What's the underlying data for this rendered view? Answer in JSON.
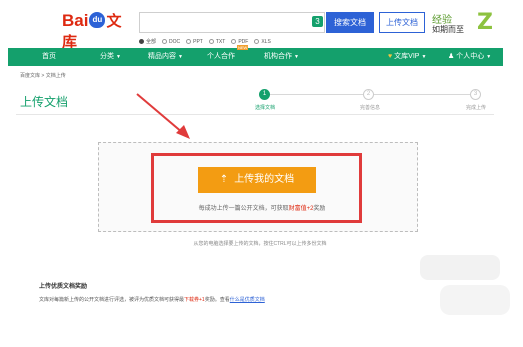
{
  "header": {
    "logo_bai": "Bai",
    "logo_du": "du",
    "logo_wenku": "文库",
    "search_value": "",
    "search_count": "3",
    "search_button": "搜索文档",
    "upload_button": "上传文档",
    "brand_line1": "经验",
    "brand_line2": "如期而至"
  },
  "filetypes": [
    {
      "label": "全部",
      "selected": true
    },
    {
      "label": "DOC",
      "selected": false
    },
    {
      "label": "PPT",
      "selected": false
    },
    {
      "label": "TXT",
      "selected": false
    },
    {
      "label": "PDF",
      "selected": false
    },
    {
      "label": "XLS",
      "selected": false
    }
  ],
  "nav": {
    "items": [
      "首页",
      "分类",
      "精品内容",
      "个人合作",
      "机构合作"
    ],
    "new_badge": "NEW",
    "vip": "文库VIP",
    "user_center": "个人中心"
  },
  "breadcrumb": "百度文库 > 文档上传",
  "page_title": "上传文档",
  "steps": {
    "labels": [
      "选择文档",
      "完善信息",
      "完成上传"
    ],
    "numbers": [
      "1",
      "2",
      "3"
    ],
    "active_index": 0
  },
  "upload": {
    "button_label": "上传我的文档",
    "reward_before": "每成功上传一篇公开文档，可获取",
    "reward_em": "财富值+2",
    "reward_after": "奖励",
    "dnd_tip": "从您的电脑选择要上传的文档，按住CTRL可以上传多份文档"
  },
  "reward_section": {
    "heading": "上传优质文档奖励",
    "text_before": "文库对每篇新上传的公开文档进行评选，被评为优质文档可获得最",
    "text_em": "下载券+1",
    "text_mid": "奖励。查看",
    "text_link": "什么是优质文档"
  },
  "colors": {
    "brand_red": "#de2910",
    "brand_green": "#14a06c",
    "button_orange": "#f39c12",
    "highlight_red": "#e03b3b",
    "baidu_blue": "#2d62d6"
  }
}
